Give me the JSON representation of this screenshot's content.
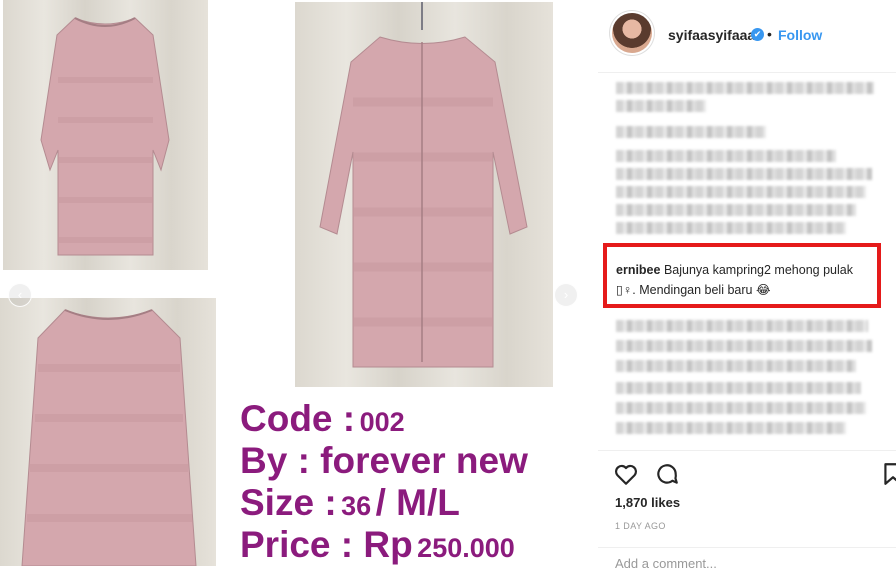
{
  "photos": {
    "nav_prev": "‹",
    "nav_next": "›"
  },
  "product_info": {
    "code_label": "Code :",
    "code_value": "002",
    "brand_label": "By : forever new",
    "size_label": "Size :",
    "size_value": "36",
    "size_suffix": "/ M/L",
    "price_label": "Price : Rp",
    "price_value": "250.000",
    "text_color": "#8b1b7d"
  },
  "post": {
    "username": "syifaasyifaaa",
    "verified_icon": "✔",
    "separator": "•",
    "follow_label": "Follow",
    "highlighted_comment": {
      "user": "ernibee",
      "text_line1": "Bajunya kampring2 mehong pulak",
      "text_line2": "▯♀. Mendingan beli baru 😂"
    },
    "likes": "1,870 likes",
    "time": "1 DAY AGO",
    "add_comment_placeholder": "Add a comment..."
  },
  "colors": {
    "accent_blue": "#3897f0",
    "highlight_red": "#e51a1a",
    "dress_pink": "#d4a7ad"
  },
  "icons": [
    "heart-icon",
    "comment-icon",
    "bookmark-icon",
    "verified-badge-icon"
  ]
}
